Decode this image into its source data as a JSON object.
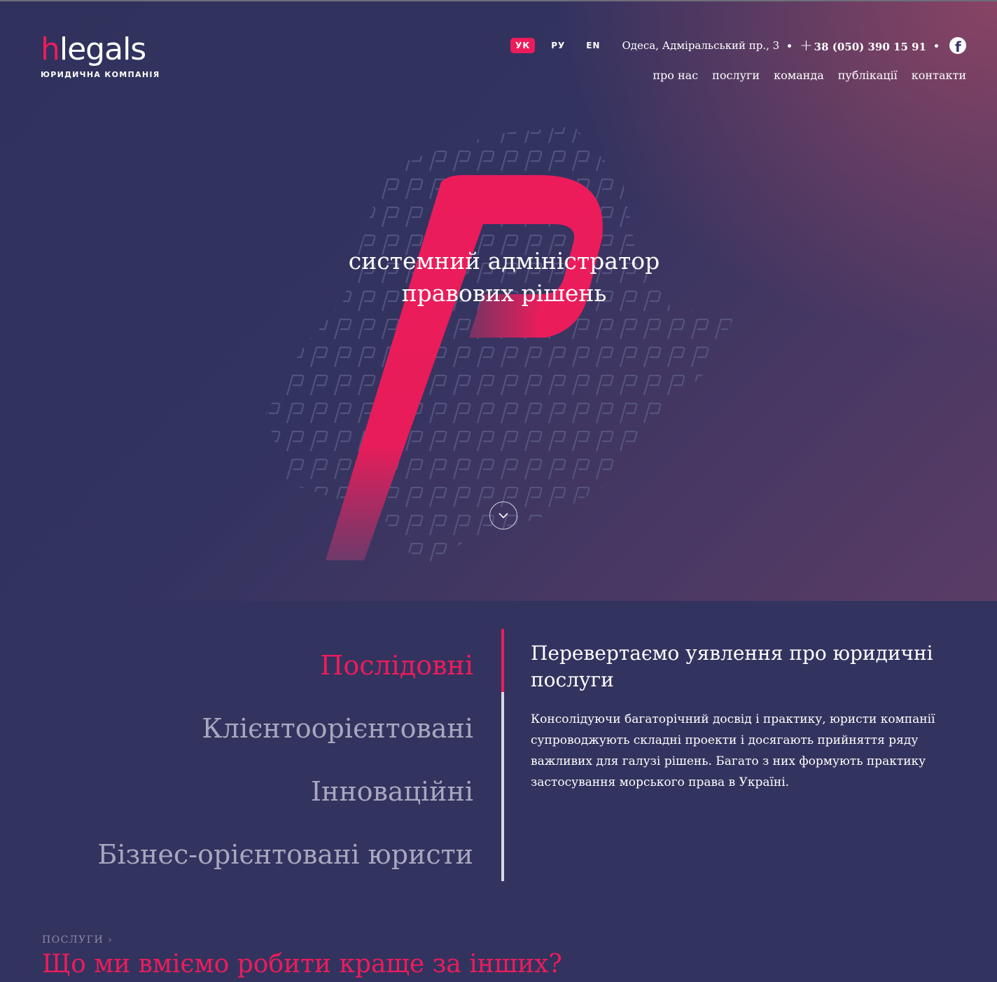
{
  "logo": {
    "brand_h": "h",
    "brand_rest": "legals",
    "subtitle": "ЮРИДИЧНА КОМПАНІЯ"
  },
  "languages": [
    {
      "label": "УК",
      "active": true
    },
    {
      "label": "РУ",
      "active": false
    },
    {
      "label": "EN",
      "active": false
    }
  ],
  "contact": {
    "address": "Одеса, Адміральський пр., 3",
    "phone": "38 (050) 390 15 91",
    "phone_prefix": "+",
    "social_icon": "facebook-icon"
  },
  "nav": {
    "items": [
      "про нас",
      "послуги",
      "команда",
      "публікації",
      "контакти"
    ]
  },
  "hero": {
    "tagline_line1": "системний адміністратор",
    "tagline_line2": "правових рішень",
    "scroll_icon": "chevron-down-icon"
  },
  "qualities": [
    "Послідовні",
    "Клієнтоорієнтовані",
    "Інноваційні",
    "Бізнес-орієнтовані юристи"
  ],
  "about": {
    "title": "Перевертаємо уявлення про юридичні послуги",
    "text": "Консолідуючи багаторічний досвід і практику, юристи компанії супроводжують складні проекти і досягають прийняття ряду важливих для галузі рішень. Багато з них формують практику застосування морського права в Україні."
  },
  "services": {
    "label": "ПОСЛУГИ",
    "title": "Що ми вміємо робити краще за інших?"
  },
  "colors": {
    "accent": "#ec1c5b",
    "background": "#33335f"
  }
}
